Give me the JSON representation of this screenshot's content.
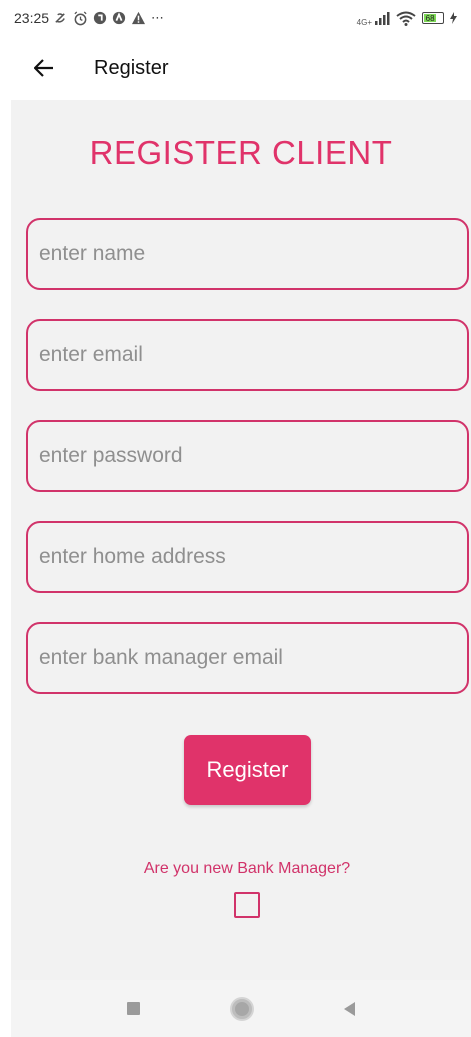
{
  "status_bar": {
    "time": "23:25",
    "extra_icons": "⋯",
    "network": "4G+",
    "battery": "68"
  },
  "app_bar": {
    "title": "Register"
  },
  "form": {
    "heading": "REGISTER CLIENT",
    "fields": [
      {
        "placeholder": "enter name"
      },
      {
        "placeholder": "enter email"
      },
      {
        "placeholder": "enter password"
      },
      {
        "placeholder": "enter home address"
      },
      {
        "placeholder": "enter bank manager email"
      }
    ],
    "register_label": "Register",
    "bank_manager_question": "Are you new Bank Manager?",
    "bank_manager_checked": false
  },
  "colors": {
    "accent": "#e0336a",
    "border": "#d1336a",
    "background": "#f2f2f2"
  }
}
